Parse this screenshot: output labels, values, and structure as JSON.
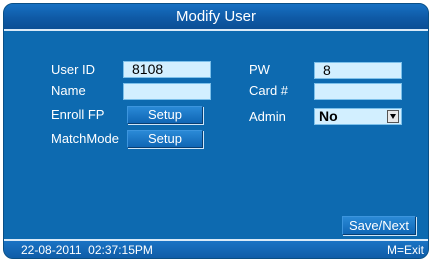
{
  "title": "Modify User",
  "form": {
    "user_id": {
      "label": "User ID",
      "value": "8108"
    },
    "name": {
      "label": "Name",
      "value": ""
    },
    "enroll_fp": {
      "label": "Enroll FP",
      "button": "Setup"
    },
    "match_mode": {
      "label": "MatchMode",
      "button": "Setup"
    },
    "pw": {
      "label": "PW",
      "value": "8"
    },
    "card": {
      "label": "Card #",
      "value": ""
    },
    "admin": {
      "label": "Admin",
      "value": "No",
      "icon": "chevron-down-icon"
    }
  },
  "buttons": {
    "save_next": "Save/Next"
  },
  "status": {
    "datetime": "22-08-2011  02:37:15PM",
    "exit_hint": "M=Exit"
  },
  "colors": {
    "background": "#0d6ab0",
    "field": "#d2efff",
    "text": "#ffffff"
  }
}
